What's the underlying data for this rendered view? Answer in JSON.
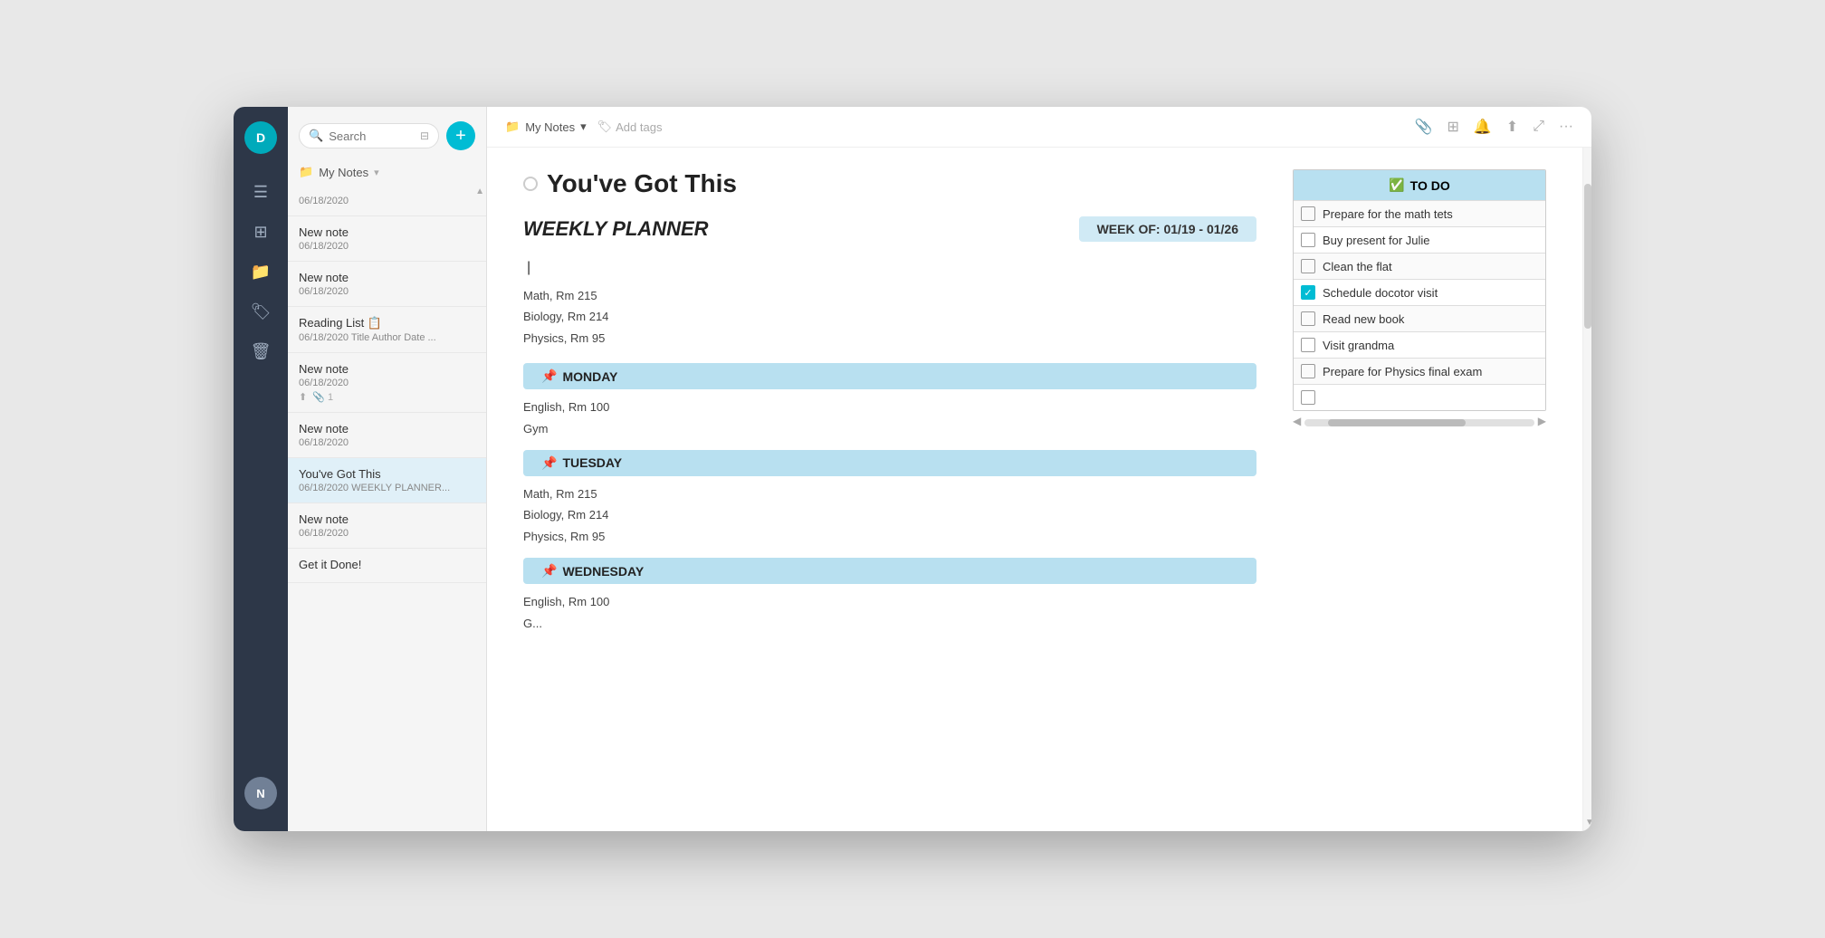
{
  "app": {
    "title": "My Notes"
  },
  "sidebar": {
    "avatar_initial": "D",
    "bottom_avatar": "N",
    "icons": [
      "☰",
      "⊞",
      "📁",
      "🏷",
      "🗑"
    ]
  },
  "search": {
    "placeholder": "Search"
  },
  "notes_folder": {
    "label": "My Notes"
  },
  "add_button_label": "+",
  "notes": [
    {
      "title": "New note",
      "date": "06/18/2020",
      "preview": "",
      "meta": []
    },
    {
      "title": "New note",
      "date": "06/18/2020",
      "preview": "",
      "meta": []
    },
    {
      "title": "Reading List 📋",
      "date": "06/18/2020",
      "preview": "Title Author Date ...",
      "meta": []
    },
    {
      "title": "New note",
      "date": "06/18/2020",
      "preview": "",
      "meta": [
        "share",
        "paperclip-1"
      ]
    },
    {
      "title": "New note",
      "date": "06/18/2020",
      "preview": "",
      "meta": []
    },
    {
      "title": "You've Got This",
      "date": "06/18/2020",
      "preview": "WEEKLY PLANNER...",
      "meta": [],
      "active": true
    },
    {
      "title": "New note",
      "date": "06/18/2020",
      "preview": "",
      "meta": []
    },
    {
      "title": "Get it Done!",
      "date": "",
      "preview": "",
      "meta": []
    }
  ],
  "breadcrumb": {
    "folder_icon": "📁",
    "folder_name": "My Notes",
    "dropdown_icon": "▾",
    "tag_icon": "🏷",
    "tag_placeholder": "Add tags"
  },
  "toolbar_actions": {
    "attach": "📎",
    "grid": "⊞",
    "bell": "🔔",
    "share": "⬆",
    "expand": "⤢",
    "more": "···"
  },
  "note": {
    "title": "You've Got This",
    "planner_title": "WEEKLY PLANNER",
    "week_label": "WEEK OF: 01/19 - 01/26",
    "classes": [
      "Math, Rm 215",
      "Biology, Rm 214",
      "Physics, Rm 95"
    ],
    "days": [
      {
        "name": "MONDAY",
        "emoji": "📌",
        "classes": [
          "English, Rm 100",
          "Gym"
        ]
      },
      {
        "name": "TUESDAY",
        "emoji": "📌",
        "classes": [
          "Math, Rm 215",
          "Biology, Rm 214",
          "Physics, Rm 95"
        ]
      },
      {
        "name": "WEDNESDAY",
        "emoji": "📌",
        "classes": [
          "English, Rm 100",
          "G..."
        ]
      }
    ],
    "todo": {
      "header_emoji": "✅",
      "header_label": "TO DO",
      "items": [
        {
          "label": "Prepare for the math tets",
          "checked": false
        },
        {
          "label": "Buy present for Julie",
          "checked": false
        },
        {
          "label": "Clean the flat",
          "checked": false
        },
        {
          "label": "Schedule docotor visit",
          "checked": true
        },
        {
          "label": "Read new book",
          "checked": false
        },
        {
          "label": "Visit grandma",
          "checked": false
        },
        {
          "label": "Prepare for Physics final exam",
          "checked": false
        },
        {
          "label": "",
          "checked": false
        }
      ]
    }
  }
}
